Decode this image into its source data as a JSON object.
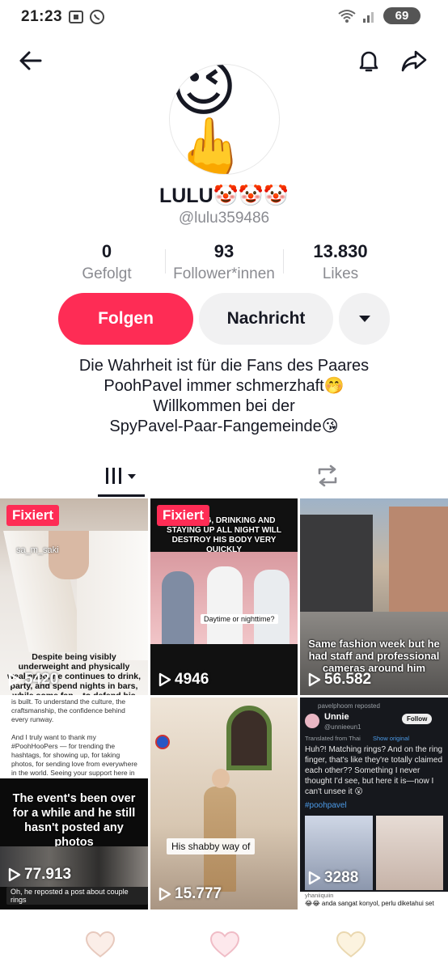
{
  "status_bar": {
    "time": "21:23",
    "battery": "69",
    "icons": [
      "screenshot-icon",
      "whatsapp-icon",
      "wifi-icon",
      "signal-icon",
      "battery-icon"
    ]
  },
  "header": {
    "icons": [
      "back-arrow-icon",
      "bell-icon",
      "share-icon"
    ]
  },
  "profile": {
    "avatar_emoji": "😉🖕",
    "name": "LULU🤡🤡🤡",
    "handle": "@lulu359486"
  },
  "stats": [
    {
      "value": "0",
      "label": "Gefolgt"
    },
    {
      "value": "93",
      "label": "Follower*innen"
    },
    {
      "value": "13.830",
      "label": "Likes"
    }
  ],
  "actions": {
    "follow": "Folgen",
    "message": "Nachricht"
  },
  "bio": [
    "Die Wahrheit ist für die Fans des Paares",
    "PoohPavel immer schmerzhaft🤭",
    "Willkommen bei der",
    "SpyPavel-Paar-Fangemeinde😘"
  ],
  "tabs": [
    {
      "name": "videos",
      "icon": "grid-icon",
      "active": true
    },
    {
      "name": "reposts",
      "icon": "repost-icon",
      "active": false
    }
  ],
  "videos": [
    {
      "pinned_label": "Fixiert",
      "views": "5420",
      "caption": "Despite being visibly underweight and physically weakened, he continues to drink, party, and spend nights in bars, while some fan... to defend his behavior",
      "overlay": "sa_m_saki"
    },
    {
      "pinned_label": "Fixiert",
      "views": "4946",
      "caption_top": "SMOKING, DRINKING AND STAYING UP ALL NIGHT WILL DESTROY HIS BODY VERY QUICKLY",
      "subtitle": "Daytime or nighttime?"
    },
    {
      "views": "56.582",
      "caption": "Same fashion week but he had staff and professional cameras around him"
    },
    {
      "views": "77.913",
      "text_block": "is built. To understand the culture, the craftsmanship, the confidence behind every runway.\n\nAnd I truly want to thank my #PoohHooPers — for trending the hashtags, for showing up, for taking photos, for sending love from everywhere in the world. Seeing your support here in Milan, even far from home, made this experience even more special. You turned this milestone into something unforgettable.",
      "headline": "The event's been over for a while and he still hasn't posted any photos",
      "footer": "Oh, he reposted a post about couple rings"
    },
    {
      "views": "15.777",
      "caption": "His shabby way of"
    },
    {
      "views": "3288",
      "repost_by": "pavelphoom reposted",
      "user": "Unnie",
      "user_handle": "@unnieeun1",
      "follow": "Follow",
      "translated": "Translated from Thai",
      "show_original": "Show original",
      "text": "Huh?! Matching rings? And on the ring finger, that's like they're totally claimed each other?? Something I never thought I'd see, but here it is—now I can't unsee it 😮",
      "hashtag": "#poohpavel",
      "footer_user": "yhaniiquiin",
      "footer_text": "😂😂 anda sangat konyol, perlu diketahui set"
    }
  ],
  "bottom_nav": {
    "icons": [
      "heart-icon",
      "heart-icon",
      "heart-icon"
    ]
  }
}
